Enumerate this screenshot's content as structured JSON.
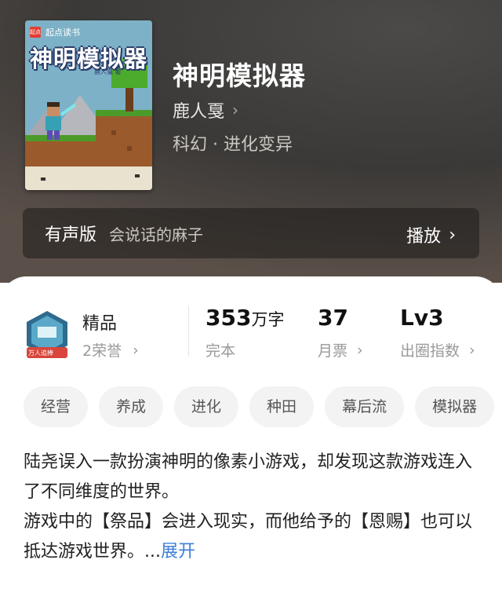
{
  "book": {
    "cover_brand": "起点读书",
    "cover_brand_mark": "起点",
    "cover_title": "神明模拟器",
    "cover_author": "鹿人戛 著",
    "title": "神明模拟器",
    "author": "鹿人戛",
    "genre": "科幻 · 进化变异"
  },
  "audio": {
    "label": "有声版",
    "narrator": "会说话的麻子",
    "play_label": "播放"
  },
  "stats": {
    "quality": "精品",
    "honor": "2荣誉",
    "badge_text": "万人追捧",
    "word_count": "353",
    "word_unit": "万字",
    "status": "完本",
    "monthly_votes": "37",
    "monthly_votes_label": "月票",
    "level": "Lv3",
    "level_label": "出圈指数"
  },
  "tags": [
    "经营",
    "养成",
    "进化",
    "种田",
    "幕后流",
    "模拟器"
  ],
  "description": {
    "line1": "陆尧误入一款扮演神明的像素小游戏，却发现这款游戏连入了不同维度的世界。",
    "line2": "游戏中的【祭品】会进入现实，而他给予的【恩赐】也可以抵达游戏世界。...",
    "expand": "展开"
  },
  "colors": {
    "accent_link": "#3d7fd9",
    "brand_red": "#e43d31"
  }
}
